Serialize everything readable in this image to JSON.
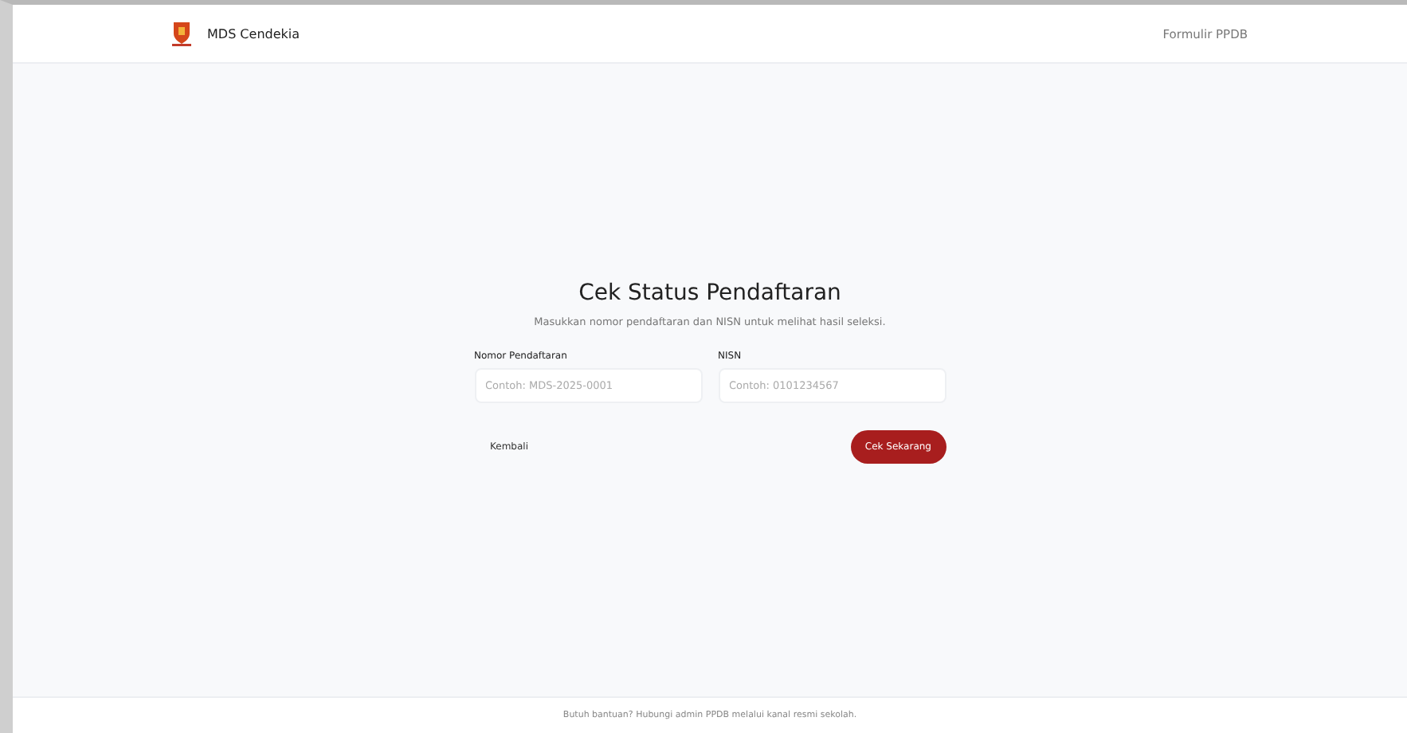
{
  "header": {
    "brand": "MDS Cendekia",
    "nav_link": "Formulir PPDB"
  },
  "form": {
    "title": "Cek Status Pendaftaran",
    "subtitle": "Masukkan nomor pendaftaran dan NISN untuk melihat hasil seleksi.",
    "fields": [
      {
        "label": "Nomor Pendaftaran",
        "placeholder": "Contoh: MDS-2025-0001"
      },
      {
        "label": "NISN",
        "placeholder": "Contoh: 0101234567"
      }
    ],
    "back_button": "Kembali",
    "submit_button": "Cek Sekarang"
  },
  "footer": "Butuh bantuan? Hubungi admin PPDB melalui kanal resmi sekolah."
}
